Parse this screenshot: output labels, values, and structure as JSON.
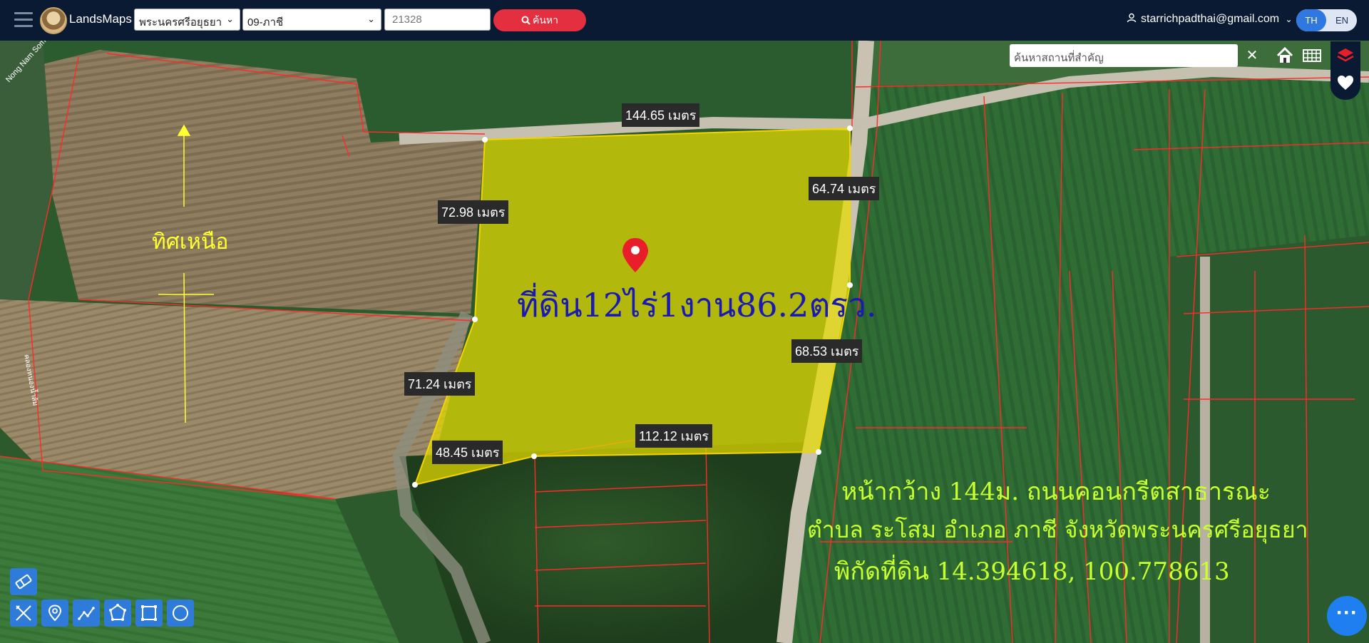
{
  "app": {
    "name": "LandsMaps",
    "province_select": "พระนครศรีอยุธยา",
    "district_select": "09-ภาชี",
    "parcel_number": "21328",
    "search_label": "ค้นหา",
    "user_email": "starrichpadthai@gmail.com",
    "lang_th": "TH",
    "lang_en": "EN"
  },
  "map": {
    "place_search_placeholder": "ค้นหาสถานที่สำคัญ",
    "clear_label": "✕",
    "road_label": "Nong Nam Som",
    "canal_label": "คลองหนองน้ำส้ม",
    "north_label": "ทิศเหนือ",
    "parcel_label": "ที่ดิน12ไร่1งาน86.2ตรว.",
    "measurements": {
      "top": "144.65 เมตร",
      "upper_left": "72.98 เมตร",
      "upper_right": "64.74 เมตร",
      "lower_right": "68.53 เมตร",
      "lower_left": "71.24 เมตร",
      "bottom_left": "48.45 เมตร",
      "bottom": "112.12 เมตร"
    },
    "caption": {
      "line1": "หน้ากว้าง 144ม. ถนนคอนกรีตสาธารณะ",
      "line2": "ตำบล ระโสม อำเภอ ภาชี จังหวัดพระนครศรีอยุธยา",
      "line3": "พิกัดที่ดิน 14.394618, 100.778613"
    }
  },
  "colors": {
    "topbar": "#0b1a33",
    "search_button": "#e32f3f",
    "parcel_fill": "#e6dc00",
    "parcel_label": "#1a1ab0",
    "caption_text": "#c8ff30",
    "north_text": "#ffff33",
    "boundary": "#ff2a2a",
    "tool_button": "#2e7bd9"
  },
  "icons": [
    "menu-icon",
    "search-icon",
    "user-icon",
    "home-icon",
    "grid-icon",
    "layers-icon",
    "heart-icon",
    "eraser-icon",
    "measure-icon",
    "pin-icon",
    "polyline-icon",
    "polygon-icon",
    "rectangle-icon",
    "circle-icon",
    "more-icon",
    "map-pin-icon"
  ]
}
